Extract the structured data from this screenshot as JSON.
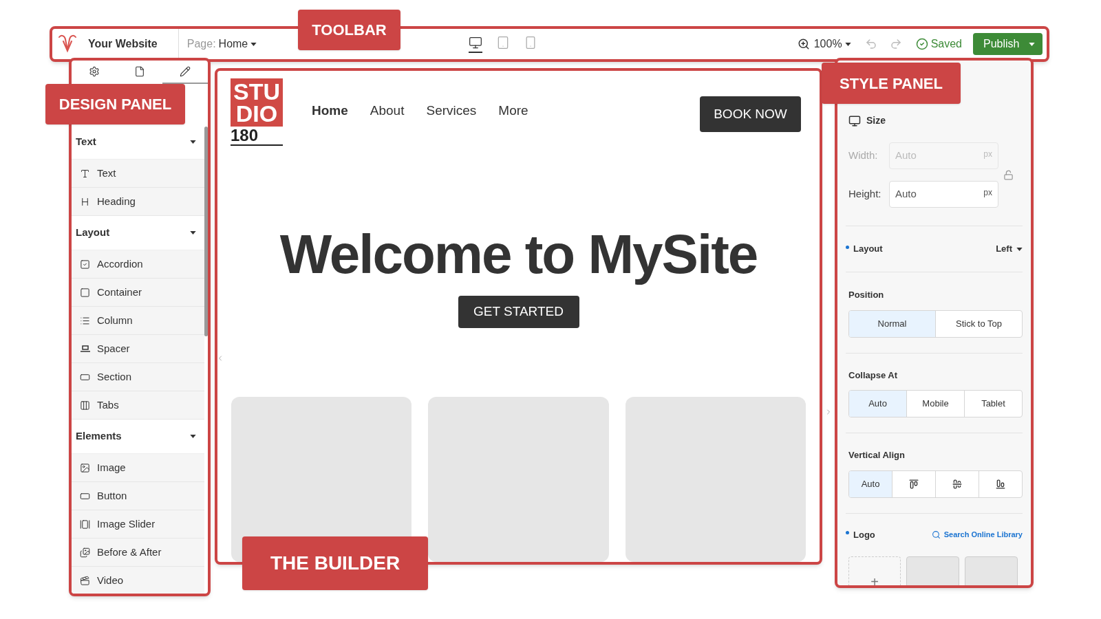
{
  "annotations": [
    {
      "label": "TOOLBAR"
    },
    {
      "label": "DESIGN PANEL"
    },
    {
      "label": "STYLE PANEL"
    },
    {
      "label": "THE BUILDER"
    }
  ],
  "toolbar": {
    "site_name": "Your Website",
    "page_label": "Page:",
    "page": "Home",
    "devices": [
      {
        "kind": "desktop",
        "selected": true
      },
      {
        "kind": "tablet",
        "selected": false
      },
      {
        "kind": "phone",
        "selected": false
      }
    ],
    "zoom": "100%",
    "status": "Saved",
    "publish": "Publish"
  },
  "design_panel": {
    "tabs": [
      {
        "kind": "settings",
        "selected": false
      },
      {
        "kind": "page",
        "selected": false
      },
      {
        "kind": "edit",
        "selected": true
      }
    ],
    "groups": [
      {
        "title": "Text",
        "expanded": true,
        "items": [
          {
            "kind": "text",
            "label": "Text"
          },
          {
            "kind": "heading",
            "label": "Heading"
          }
        ]
      },
      {
        "title": "Layout",
        "expanded": true,
        "items": [
          {
            "kind": "accordion",
            "label": "Accordion"
          },
          {
            "kind": "container",
            "label": "Container"
          },
          {
            "kind": "column",
            "label": "Column"
          },
          {
            "kind": "spacer",
            "label": "Spacer"
          },
          {
            "kind": "section",
            "label": "Section"
          },
          {
            "kind": "tabs",
            "label": "Tabs"
          }
        ]
      },
      {
        "title": "Elements",
        "expanded": true,
        "items": [
          {
            "kind": "image",
            "label": "Image"
          },
          {
            "kind": "button",
            "label": "Button"
          },
          {
            "kind": "slider",
            "label": "Image Slider"
          },
          {
            "kind": "compare",
            "label": "Before & After"
          },
          {
            "kind": "video",
            "label": "Video"
          }
        ]
      }
    ]
  },
  "builder": {
    "logo": {
      "line_1": "STU",
      "line_2": "DIO",
      "line_3": "180"
    },
    "nav": [
      {
        "label": "Home",
        "selected": true
      },
      {
        "label": "About",
        "selected": false
      },
      {
        "label": "Services",
        "selected": false
      },
      {
        "label": "More",
        "selected": false
      }
    ],
    "cta": "BOOK NOW",
    "headline": "Welcome to MySite",
    "button": "GET STARTED"
  },
  "style_panel": {
    "size": {
      "title": "Size",
      "fields": [
        {
          "label": "Width:",
          "placeholder": "Auto",
          "unit": "px",
          "disabled": true
        },
        {
          "label": "Height:",
          "value": "Auto",
          "unit": "px",
          "disabled": false
        }
      ]
    },
    "layout": {
      "label": "Layout",
      "value": "Left",
      "modified": true
    },
    "position": {
      "label": "Position",
      "options": [
        {
          "label": "Normal",
          "selected": true
        },
        {
          "label": "Stick to Top",
          "selected": false
        }
      ]
    },
    "collapse": {
      "label": "Collapse At",
      "options": [
        {
          "label": "Auto",
          "selected": true
        },
        {
          "label": "Mobile",
          "selected": false
        },
        {
          "label": "Tablet",
          "selected": false
        }
      ]
    },
    "vertical_align": {
      "label": "Vertical Align",
      "options": [
        {
          "kind": "text",
          "label": "Auto",
          "selected": true
        },
        {
          "kind": "top",
          "selected": false
        },
        {
          "kind": "middle",
          "selected": false
        },
        {
          "kind": "bottom",
          "selected": false
        }
      ]
    },
    "logo": {
      "label": "Logo",
      "modified": true,
      "link": "Search Online Library",
      "add": "+"
    }
  }
}
